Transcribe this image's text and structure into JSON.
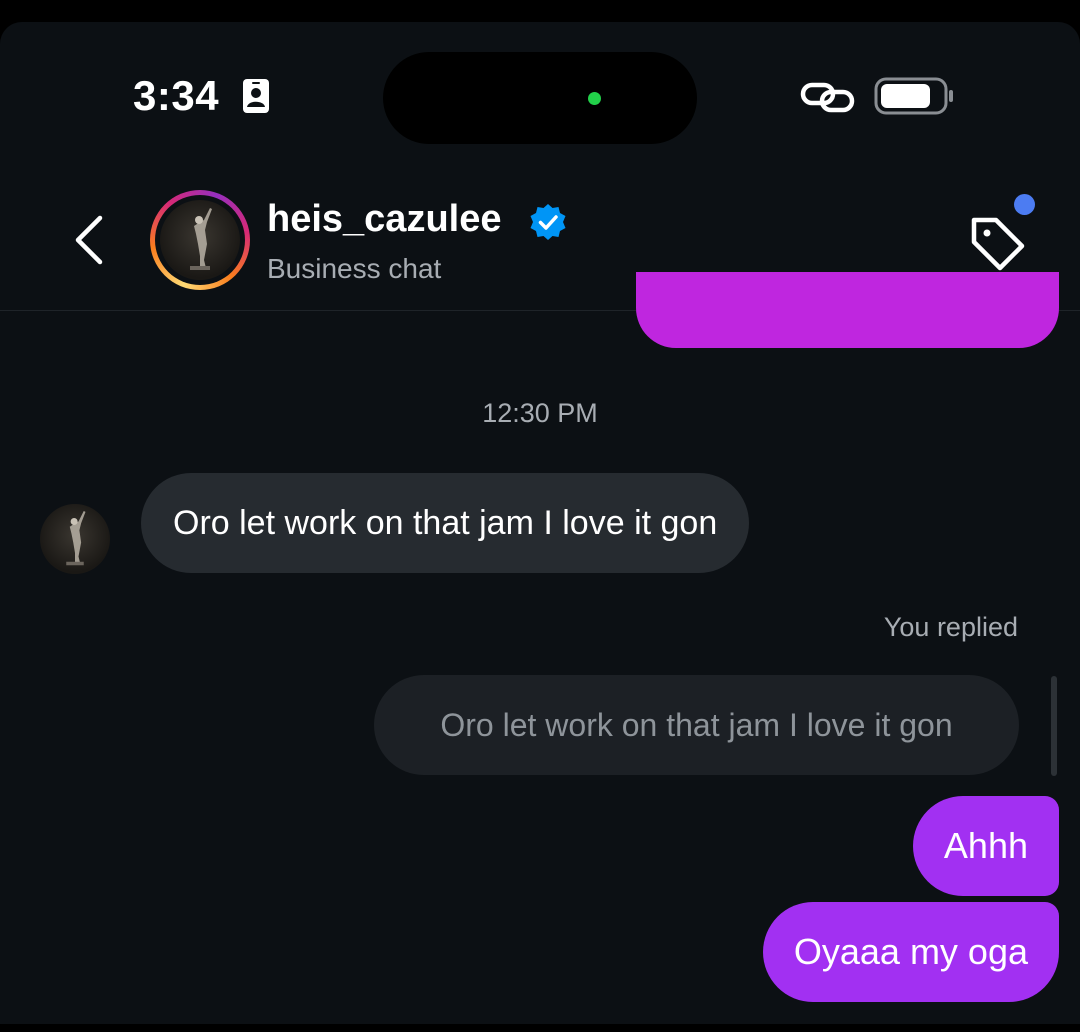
{
  "status_bar": {
    "time": "3:34",
    "icons": [
      "id-card-icon",
      "link-icon",
      "battery-icon"
    ],
    "island_indicator_color": "#22d04a"
  },
  "header": {
    "username": "heis_cazulee",
    "subtitle": "Business chat",
    "verified": true,
    "icons": [
      "back-chevron-icon",
      "verified-badge-icon",
      "tag-icon"
    ],
    "notification_dot_color": "#4c7cf2",
    "avatar_ring": "story-gradient"
  },
  "conversation": {
    "timestamp": "12:30 PM",
    "incoming_message": "Oro let work on that jam I love it gon",
    "reply_label": "You replied",
    "quoted_message": "Oro let work on that jam I love it gon",
    "outgoing_messages": [
      "Ahhh",
      "Oyaaa my oga"
    ]
  },
  "colors": {
    "background": "#0c1014",
    "outgoing_bubble": "#a230f2",
    "previous_outgoing_bubble": "#bf26df",
    "incoming_bubble": "#262b30",
    "quoted_bubble": "#1c2025",
    "verified_blue": "#0095f6"
  }
}
